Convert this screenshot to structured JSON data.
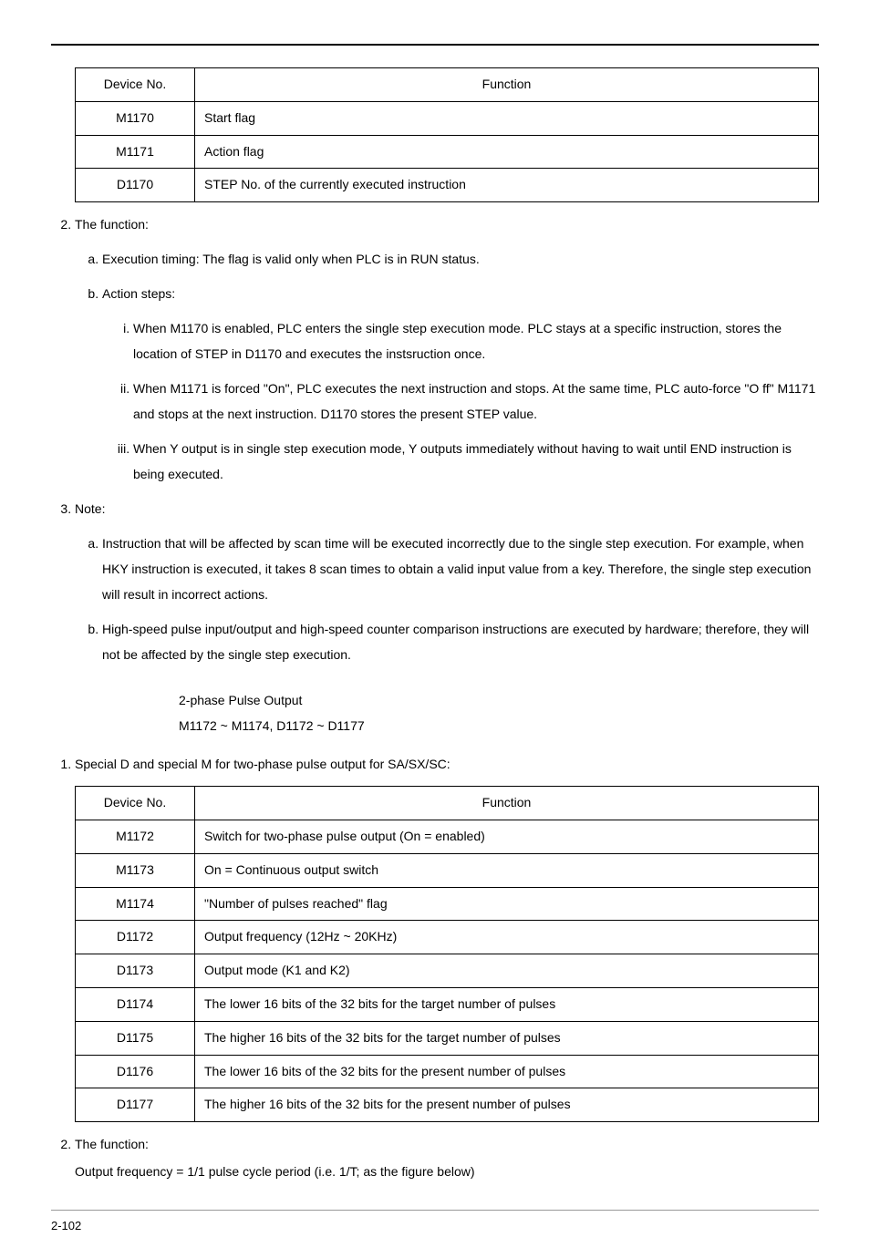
{
  "table1": {
    "headers": {
      "device": "Device No.",
      "function": "Function"
    },
    "rows": [
      {
        "device": "M1170",
        "function": "Start flag"
      },
      {
        "device": "M1171",
        "function": "Action flag"
      },
      {
        "device": "D1170",
        "function": "STEP No. of the currently executed instruction"
      }
    ]
  },
  "list1": {
    "item2": "The function:",
    "item2a": "Execution timing: The flag is valid only when PLC is in RUN status.",
    "item2b": "Action steps:",
    "item2b_i": "When M1170 is enabled, PLC enters the single step execution mode. PLC stays at a specific instruction, stores the location of STEP in D1170 and executes the instsruction once.",
    "item2b_ii": "When M1171 is forced \"On\", PLC executes the next instruction and stops. At the same time, PLC auto-force \"O ff\" M1171 and stops at the next instruction. D1170 stores the present STEP value.",
    "item2b_iii": "When Y output is in single step execution mode, Y outputs immediately without having to wait until END instruction is being executed.",
    "item3": "Note:",
    "item3a": "Instruction that will be affected by scan time will be executed incorrectly due to the single step execution. For example, when HKY instruction is executed, it takes 8 scan times to obtain a valid input value from a key. Therefore, the single step execution will result in incorrect actions.",
    "item3b": "High-speed pulse input/output and high-speed counter comparison instructions are executed by hardware; therefore, they will not be affected by the single step execution."
  },
  "title_block": {
    "line1": "2-phase Pulse Output",
    "line2": "M1172 ~ M1174, D1172 ~ D1177"
  },
  "list2": {
    "intro1": "Special D and special M for two-phase pulse output for SA/SX/SC:"
  },
  "table2": {
    "headers": {
      "device": "Device No.",
      "function": "Function"
    },
    "rows": [
      {
        "device": "M1172",
        "function": "Switch for two-phase pulse output (On = enabled)"
      },
      {
        "device": "M1173",
        "function": "On = Continuous output switch"
      },
      {
        "device": "M1174",
        "function": "\"Number of pulses reached\" flag"
      },
      {
        "device": "D1172",
        "function": "Output frequency (12Hz ~ 20KHz)"
      },
      {
        "device": "D1173",
        "function": "Output mode (K1 and K2)"
      },
      {
        "device": "D1174",
        "function": "The lower 16 bits of the 32 bits for the target number of pulses"
      },
      {
        "device": "D1175",
        "function": "The higher 16 bits of the 32 bits for the target number of pulses"
      },
      {
        "device": "D1176",
        "function": "The lower 16 bits of the 32 bits for the present number of pulses"
      },
      {
        "device": "D1177",
        "function": "The higher 16 bits of the 32 bits for the present number of pulses"
      }
    ]
  },
  "list3": {
    "item2": "The function:",
    "item2_sub": "Output frequency = 1/1 pulse cycle period (i.e. 1/T; as the figure below)"
  },
  "footer": {
    "page": "2-102"
  }
}
